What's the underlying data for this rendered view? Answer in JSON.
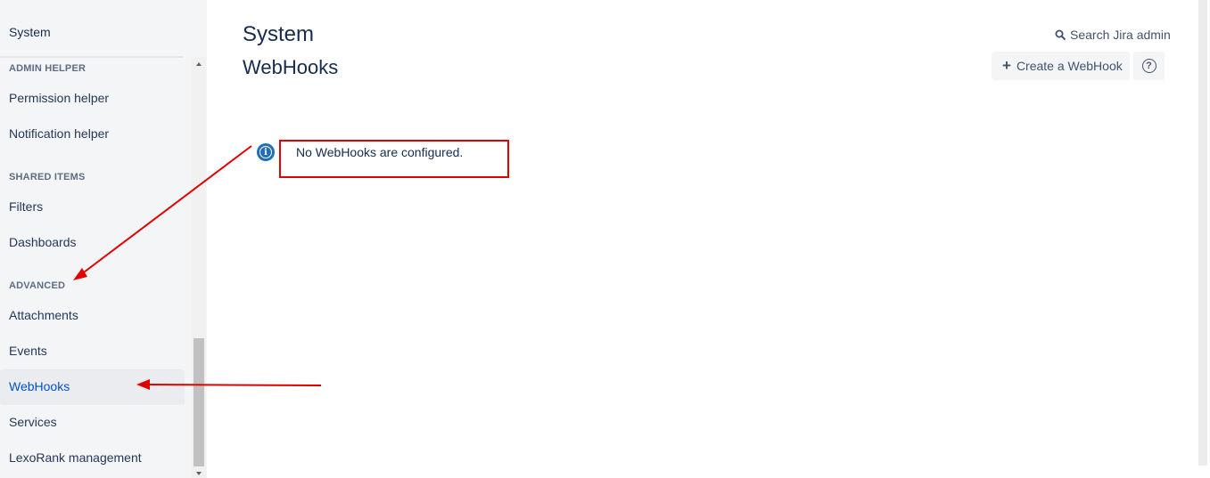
{
  "sidebar": {
    "title": "System",
    "sections": [
      {
        "heading": "ADMIN HELPER",
        "items": [
          "Permission helper",
          "Notification helper"
        ]
      },
      {
        "heading": "SHARED ITEMS",
        "items": [
          "Filters",
          "Dashboards"
        ]
      },
      {
        "heading": "ADVANCED",
        "items": [
          "Attachments",
          "Events",
          "WebHooks",
          "Services",
          "LexoRank management"
        ]
      }
    ],
    "active_item": "WebHooks"
  },
  "header": {
    "title": "System",
    "subtitle": "WebHooks",
    "search_label": "Search Jira admin",
    "create_button_label": "Create a WebHook",
    "help_glyph": "?"
  },
  "main": {
    "info_message": "No WebHooks are configured.",
    "info_glyph": "i"
  },
  "annotations": {
    "color": "#e00000"
  },
  "icons": [
    "search-icon",
    "plus-icon",
    "help-icon",
    "info-icon",
    "arrow-annotation"
  ]
}
